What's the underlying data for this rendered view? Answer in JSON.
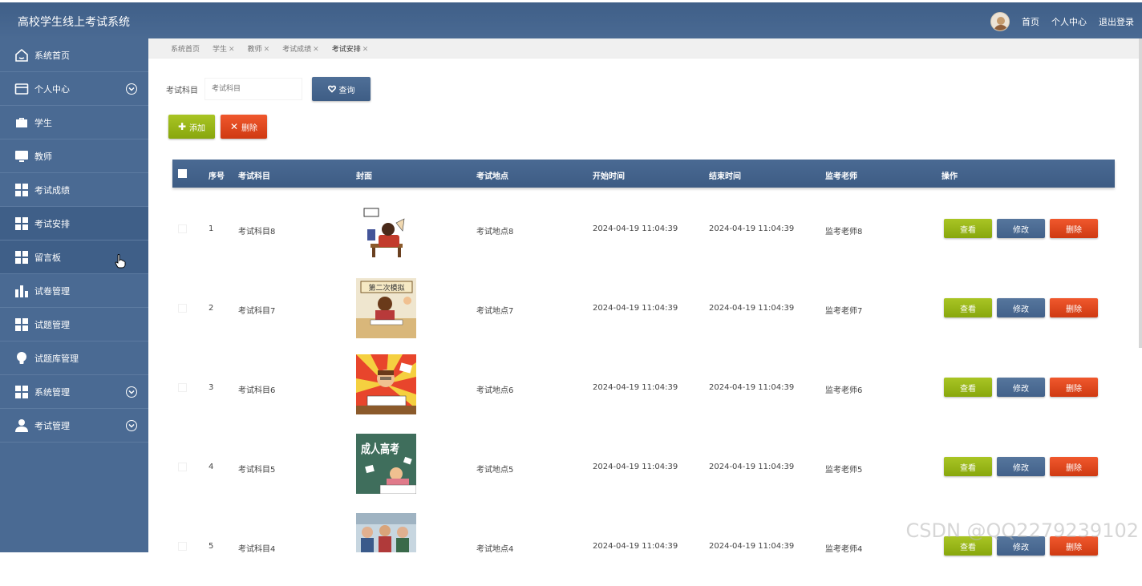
{
  "header": {
    "title": "高校学生线上考试系统",
    "links": [
      "首页",
      "个人中心",
      "退出登录"
    ]
  },
  "sidebar": {
    "items": [
      {
        "label": "系统首页",
        "icon": "home-icon",
        "expandable": false
      },
      {
        "label": "个人中心",
        "icon": "card-icon",
        "expandable": true
      },
      {
        "label": "学生",
        "icon": "briefcase-icon",
        "expandable": false
      },
      {
        "label": "教师",
        "icon": "monitor-icon",
        "expandable": false
      },
      {
        "label": "考试成绩",
        "icon": "grid-icon",
        "expandable": false
      },
      {
        "label": "考试安排",
        "icon": "grid-icon",
        "expandable": false,
        "active": true
      },
      {
        "label": "留言板",
        "icon": "grid-icon",
        "expandable": false
      },
      {
        "label": "试卷管理",
        "icon": "bar-chart-icon",
        "expandable": false
      },
      {
        "label": "试题管理",
        "icon": "grid-icon",
        "expandable": false
      },
      {
        "label": "试题库管理",
        "icon": "bulb-icon",
        "expandable": false
      },
      {
        "label": "系统管理",
        "icon": "grid-icon",
        "expandable": true
      },
      {
        "label": "考试管理",
        "icon": "user-icon",
        "expandable": true
      }
    ]
  },
  "breadcrumb": [
    "系统首页",
    "学生",
    "教师",
    "考试成绩",
    "考试安排"
  ],
  "search": {
    "label": "考试科目",
    "placeholder": "考试科目",
    "button": "查询"
  },
  "actions": {
    "add": "添加",
    "delete": "删除"
  },
  "table": {
    "columns": [
      "序号",
      "考试科目",
      "封面",
      "考试地点",
      "开始时间",
      "结束时间",
      "监考老师",
      "操作"
    ],
    "rows": [
      {
        "no": "1",
        "subject": "考试科目8",
        "location": "考试地点8",
        "start": "2024-04-19 11:04:39",
        "end": "2024-04-19 11:04:39",
        "teacher": "监考老师8",
        "cover": "cover-1"
      },
      {
        "no": "2",
        "subject": "考试科目7",
        "location": "考试地点7",
        "start": "2024-04-19 11:04:39",
        "end": "2024-04-19 11:04:39",
        "teacher": "监考老师7",
        "cover": "cover-2"
      },
      {
        "no": "3",
        "subject": "考试科目6",
        "location": "考试地点6",
        "start": "2024-04-19 11:04:39",
        "end": "2024-04-19 11:04:39",
        "teacher": "监考老师6",
        "cover": "cover-3"
      },
      {
        "no": "4",
        "subject": "考试科目5",
        "location": "考试地点5",
        "start": "2024-04-19 11:04:39",
        "end": "2024-04-19 11:04:39",
        "teacher": "监考老师5",
        "cover": "cover-4"
      },
      {
        "no": "5",
        "subject": "考试科目4",
        "location": "考试地点4",
        "start": "2024-04-19 11:04:39",
        "end": "2024-04-19 11:04:39",
        "teacher": "监考老师4",
        "cover": "cover-5"
      }
    ],
    "row_actions": {
      "view": "查看",
      "edit": "修改",
      "delete": "删除"
    }
  },
  "cover_texts": {
    "row2_sign": "第二次模拟",
    "row4_sign": "成人高考"
  },
  "watermark": "CSDN @QQ2279239102",
  "colors": {
    "header": "#4a6a93",
    "green": "#99b619",
    "blue": "#4a6a93",
    "red": "#e04a20"
  }
}
